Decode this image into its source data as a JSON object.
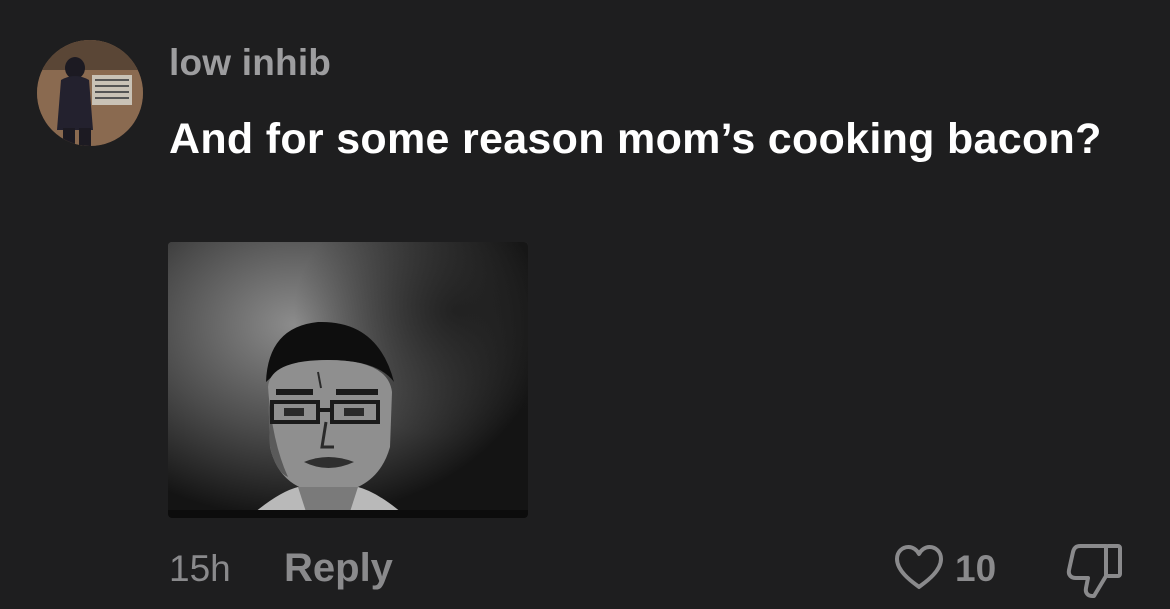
{
  "comment": {
    "username": "low inhib",
    "text": "And for some reason mom’s cooking bacon?",
    "timestamp": "15h",
    "reply_label": "Reply",
    "like_count": "10"
  },
  "icons": {
    "like": "heart-outline-icon",
    "dislike": "thumbs-down-icon"
  },
  "colors": {
    "background": "#1e1e1f",
    "username": "#9d9d9f",
    "text": "#ffffff",
    "muted": "#8a8a8c"
  }
}
